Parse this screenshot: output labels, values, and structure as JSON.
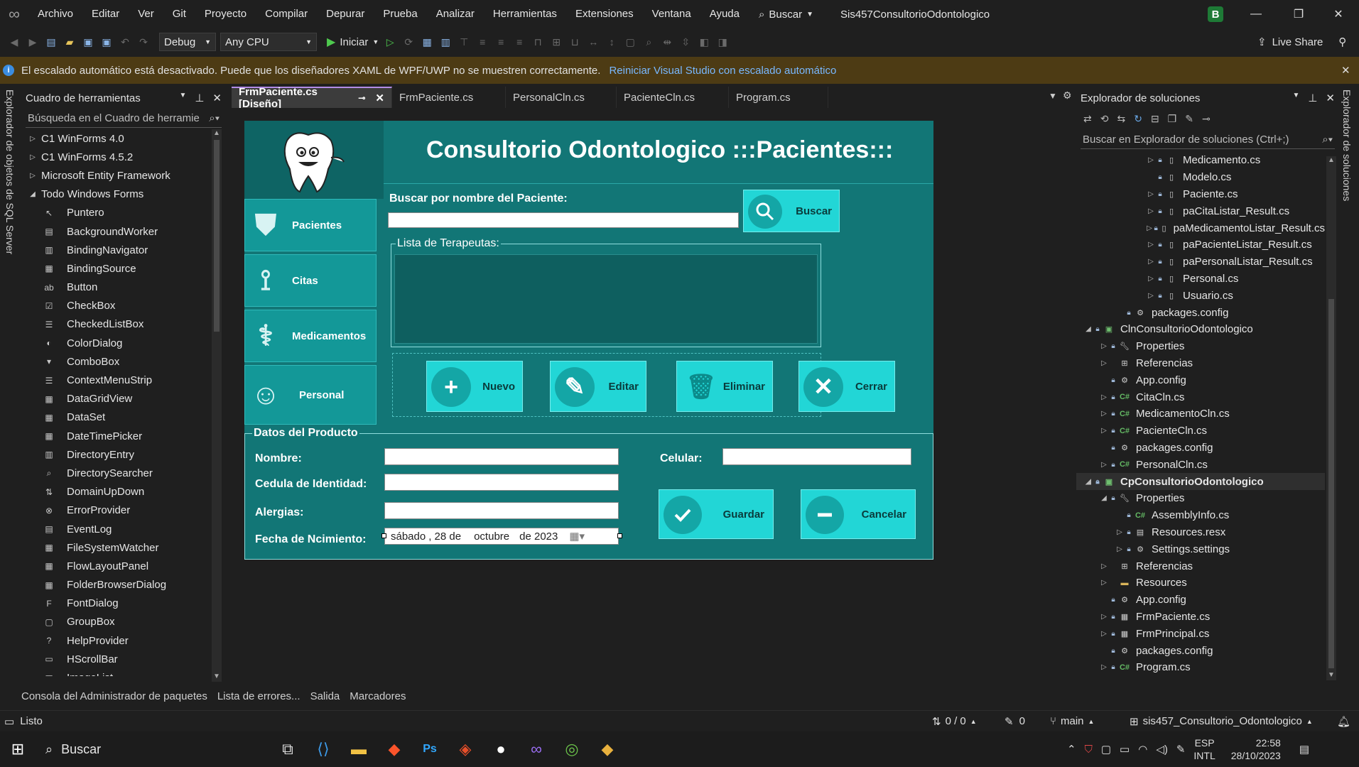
{
  "menu": {
    "items": [
      "Archivo",
      "Editar",
      "Ver",
      "Git",
      "Proyecto",
      "Compilar",
      "Depurar",
      "Prueba",
      "Analizar",
      "Herramientas",
      "Extensiones",
      "Ventana",
      "Ayuda"
    ],
    "search_label": "Buscar",
    "solution_title": "Sis457ConsultorioOdontologico",
    "avatar_letter": "B"
  },
  "toolbar": {
    "config": "Debug",
    "platform": "Any CPU",
    "start_label": "Iniciar",
    "live_share": "Live Share"
  },
  "infobar": {
    "message": "El escalado automático está desactivado. Puede que los diseñadores XAML de WPF/UWP no se muestren correctamente.",
    "link": "Reiniciar Visual Studio con escalado automático"
  },
  "left_vertical_tab": "Explorador de objetos de SQL Server",
  "right_vertical_tab": "Explorador de soluciones",
  "toolbox": {
    "title": "Cuadro de herramientas",
    "search_placeholder": "Búsqueda en el Cuadro de herramie",
    "categories": [
      "C1 WinForms 4.0",
      "C1 WinForms 4.5.2",
      "Microsoft Entity Framework",
      "Todo Windows Forms"
    ],
    "items": [
      "Puntero",
      "BackgroundWorker",
      "BindingNavigator",
      "BindingSource",
      "Button",
      "CheckBox",
      "CheckedListBox",
      "ColorDialog",
      "ComboBox",
      "ContextMenuStrip",
      "DataGridView",
      "DataSet",
      "DateTimePicker",
      "DirectoryEntry",
      "DirectorySearcher",
      "DomainUpDown",
      "ErrorProvider",
      "EventLog",
      "FileSystemWatcher",
      "FlowLayoutPanel",
      "FolderBrowserDialog",
      "FontDialog",
      "GroupBox",
      "HelpProvider",
      "HScrollBar",
      "ImageList"
    ]
  },
  "tabs": [
    "FrmPaciente.cs [Diseño]",
    "FrmPaciente.cs",
    "PersonalCln.cs",
    "PacienteCln.cs",
    "Program.cs"
  ],
  "form": {
    "title": "Consultorio Odontologico :::Pacientes:::",
    "side_buttons": [
      "Pacientes",
      "Citas",
      "Medicamentos",
      "Personal"
    ],
    "search_label": "Buscar por nombre del Paciente:",
    "search_button": "Buscar",
    "list_group": "Lista de Terapeutas:",
    "actions": [
      "Nuevo",
      "Editar",
      "Eliminar",
      "Cerrar"
    ],
    "data_group": "Datos del Producto",
    "labels": {
      "nombre": "Nombre:",
      "cedula": "Cedula de Identidad:",
      "alergias": "Alergias:",
      "fecha": "Fecha de Ncimiento:",
      "celular": "Celular:"
    },
    "date_value": {
      "day": "sábado",
      "num": ", 28 de",
      "month": "octubre",
      "year": "de 2023"
    },
    "save_button": "Guardar",
    "cancel_button": "Cancelar"
  },
  "solution_explorer": {
    "title": "Explorador de soluciones",
    "search_placeholder": "Buscar en Explorador de soluciones (Ctrl+;)",
    "rows": [
      {
        "label": "Medicamento.cs",
        "indent": 4,
        "exp": "▷",
        "lock": true,
        "icon": "file"
      },
      {
        "label": "Modelo.cs",
        "indent": 4,
        "exp": "",
        "lock": true,
        "icon": "file"
      },
      {
        "label": "Paciente.cs",
        "indent": 4,
        "exp": "▷",
        "lock": true,
        "icon": "file"
      },
      {
        "label": "paCitaListar_Result.cs",
        "indent": 4,
        "exp": "▷",
        "lock": true,
        "icon": "file"
      },
      {
        "label": "paMedicamentoListar_Result.cs",
        "indent": 4,
        "exp": "▷",
        "lock": true,
        "icon": "file"
      },
      {
        "label": "paPacienteListar_Result.cs",
        "indent": 4,
        "exp": "▷",
        "lock": true,
        "icon": "file"
      },
      {
        "label": "paPersonalListar_Result.cs",
        "indent": 4,
        "exp": "▷",
        "lock": true,
        "icon": "file"
      },
      {
        "label": "Personal.cs",
        "indent": 4,
        "exp": "▷",
        "lock": true,
        "icon": "file"
      },
      {
        "label": "Usuario.cs",
        "indent": 4,
        "exp": "▷",
        "lock": true,
        "icon": "file"
      },
      {
        "label": "packages.config",
        "indent": 2,
        "exp": "",
        "lock": true,
        "icon": "config"
      },
      {
        "label": "ClnConsultorioOdontologico",
        "indent": 0,
        "exp": "◢",
        "lock": true,
        "icon": "proj"
      },
      {
        "label": "Properties",
        "indent": 1,
        "exp": "▷",
        "lock": true,
        "icon": "wrench"
      },
      {
        "label": "Referencias",
        "indent": 1,
        "exp": "▷",
        "lock": false,
        "icon": "refs"
      },
      {
        "label": "App.config",
        "indent": 1,
        "exp": "",
        "lock": true,
        "icon": "config"
      },
      {
        "label": "CitaCln.cs",
        "indent": 1,
        "exp": "▷",
        "lock": true,
        "icon": "cs"
      },
      {
        "label": "MedicamentoCln.cs",
        "indent": 1,
        "exp": "▷",
        "lock": true,
        "icon": "cs"
      },
      {
        "label": "PacienteCln.cs",
        "indent": 1,
        "exp": "▷",
        "lock": true,
        "icon": "cs"
      },
      {
        "label": "packages.config",
        "indent": 1,
        "exp": "",
        "lock": true,
        "icon": "config"
      },
      {
        "label": "PersonalCln.cs",
        "indent": 1,
        "exp": "▷",
        "lock": true,
        "icon": "cs"
      },
      {
        "label": "CpConsultorioOdontologico",
        "indent": 0,
        "exp": "◢",
        "lock": true,
        "icon": "proj",
        "selected": true
      },
      {
        "label": "Properties",
        "indent": 1,
        "exp": "◢",
        "lock": true,
        "icon": "wrench"
      },
      {
        "label": "AssemblyInfo.cs",
        "indent": 2,
        "exp": "",
        "lock": true,
        "icon": "cs"
      },
      {
        "label": "Resources.resx",
        "indent": 2,
        "exp": "▷",
        "lock": true,
        "icon": "resx"
      },
      {
        "label": "Settings.settings",
        "indent": 2,
        "exp": "▷",
        "lock": true,
        "icon": "gear"
      },
      {
        "label": "Referencias",
        "indent": 1,
        "exp": "▷",
        "lock": false,
        "icon": "refs"
      },
      {
        "label": "Resources",
        "indent": 1,
        "exp": "▷",
        "lock": false,
        "icon": "folder"
      },
      {
        "label": "App.config",
        "indent": 1,
        "exp": "",
        "lock": true,
        "icon": "config"
      },
      {
        "label": "FrmPaciente.cs",
        "indent": 1,
        "exp": "▷",
        "lock": true,
        "icon": "form"
      },
      {
        "label": "FrmPrincipal.cs",
        "indent": 1,
        "exp": "▷",
        "lock": true,
        "icon": "form"
      },
      {
        "label": "packages.config",
        "indent": 1,
        "exp": "",
        "lock": true,
        "icon": "config"
      },
      {
        "label": "Program.cs",
        "indent": 1,
        "exp": "▷",
        "lock": true,
        "icon": "cs"
      }
    ]
  },
  "bottom_tabs": [
    "Consola del Administrador de paquetes",
    "Lista de errores...",
    "Salida",
    "Marcadores"
  ],
  "status": {
    "ready": "Listo",
    "changes": "0 / 0",
    "edits": "0",
    "branch": "main",
    "repo": "sis457_Consultorio_Odontologico"
  },
  "taskbar": {
    "search": "Buscar",
    "lang1": "ESP",
    "lang2": "INTL",
    "time": "22:58",
    "date": "28/10/2023"
  }
}
